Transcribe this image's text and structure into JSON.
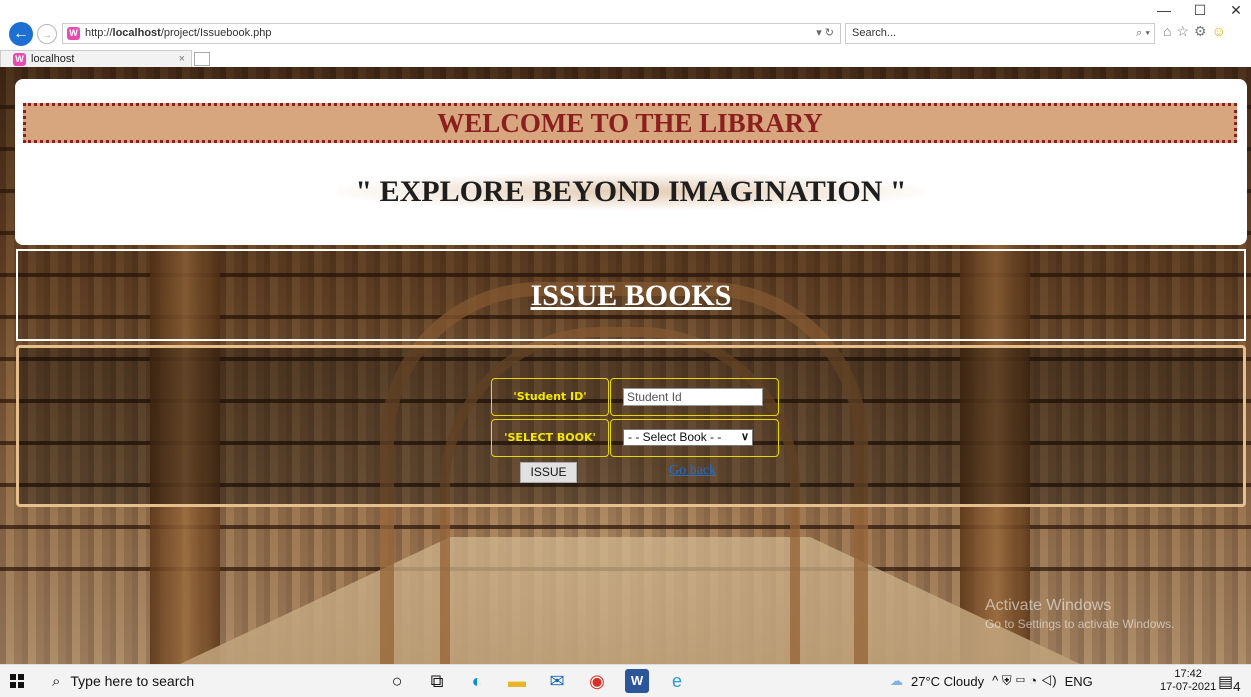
{
  "browser": {
    "url_prefix": "http://",
    "url_host": "localhost",
    "url_path": "/project/Issuebook.php",
    "address_tools": "▾ ↻",
    "search_placeholder": "Search...",
    "tab_label": "localhost",
    "window_controls": [
      "—",
      "☐",
      "✕"
    ]
  },
  "header": {
    "welcome": "WELCOME TO THE LIBRARY",
    "tagline": "\" EXPLORE BEYOND IMAGINATION \""
  },
  "page": {
    "title": "ISSUE BOOKS"
  },
  "form": {
    "student_id_label": "'Student ID'",
    "student_id_placeholder": "Student Id",
    "select_book_label": "'SELECT BOOK'",
    "select_book_value": "- - Select Book - -",
    "issue_button": "ISSUE",
    "go_back_link": "Go back"
  },
  "watermark": {
    "line1": "Activate Windows",
    "line2": "Go to Settings to activate Windows."
  },
  "taskbar": {
    "search_text": "Type here to search",
    "weather": "27°C  Cloudy",
    "language": "ENG",
    "time": "17:42",
    "date": "17-07-2021",
    "notification_count": "4",
    "icons": [
      "cortana-icon",
      "task-view-icon",
      "edge-icon",
      "file-explorer-icon",
      "mail-icon",
      "chrome-icon",
      "word-icon",
      "internet-explorer-icon"
    ]
  },
  "colors": {
    "welcome_bg": "#d7a57e",
    "welcome_text": "#8b1f1f",
    "label_text": "#f3e900",
    "link": "#1a6fd8",
    "form_border": "#e5c08e"
  }
}
